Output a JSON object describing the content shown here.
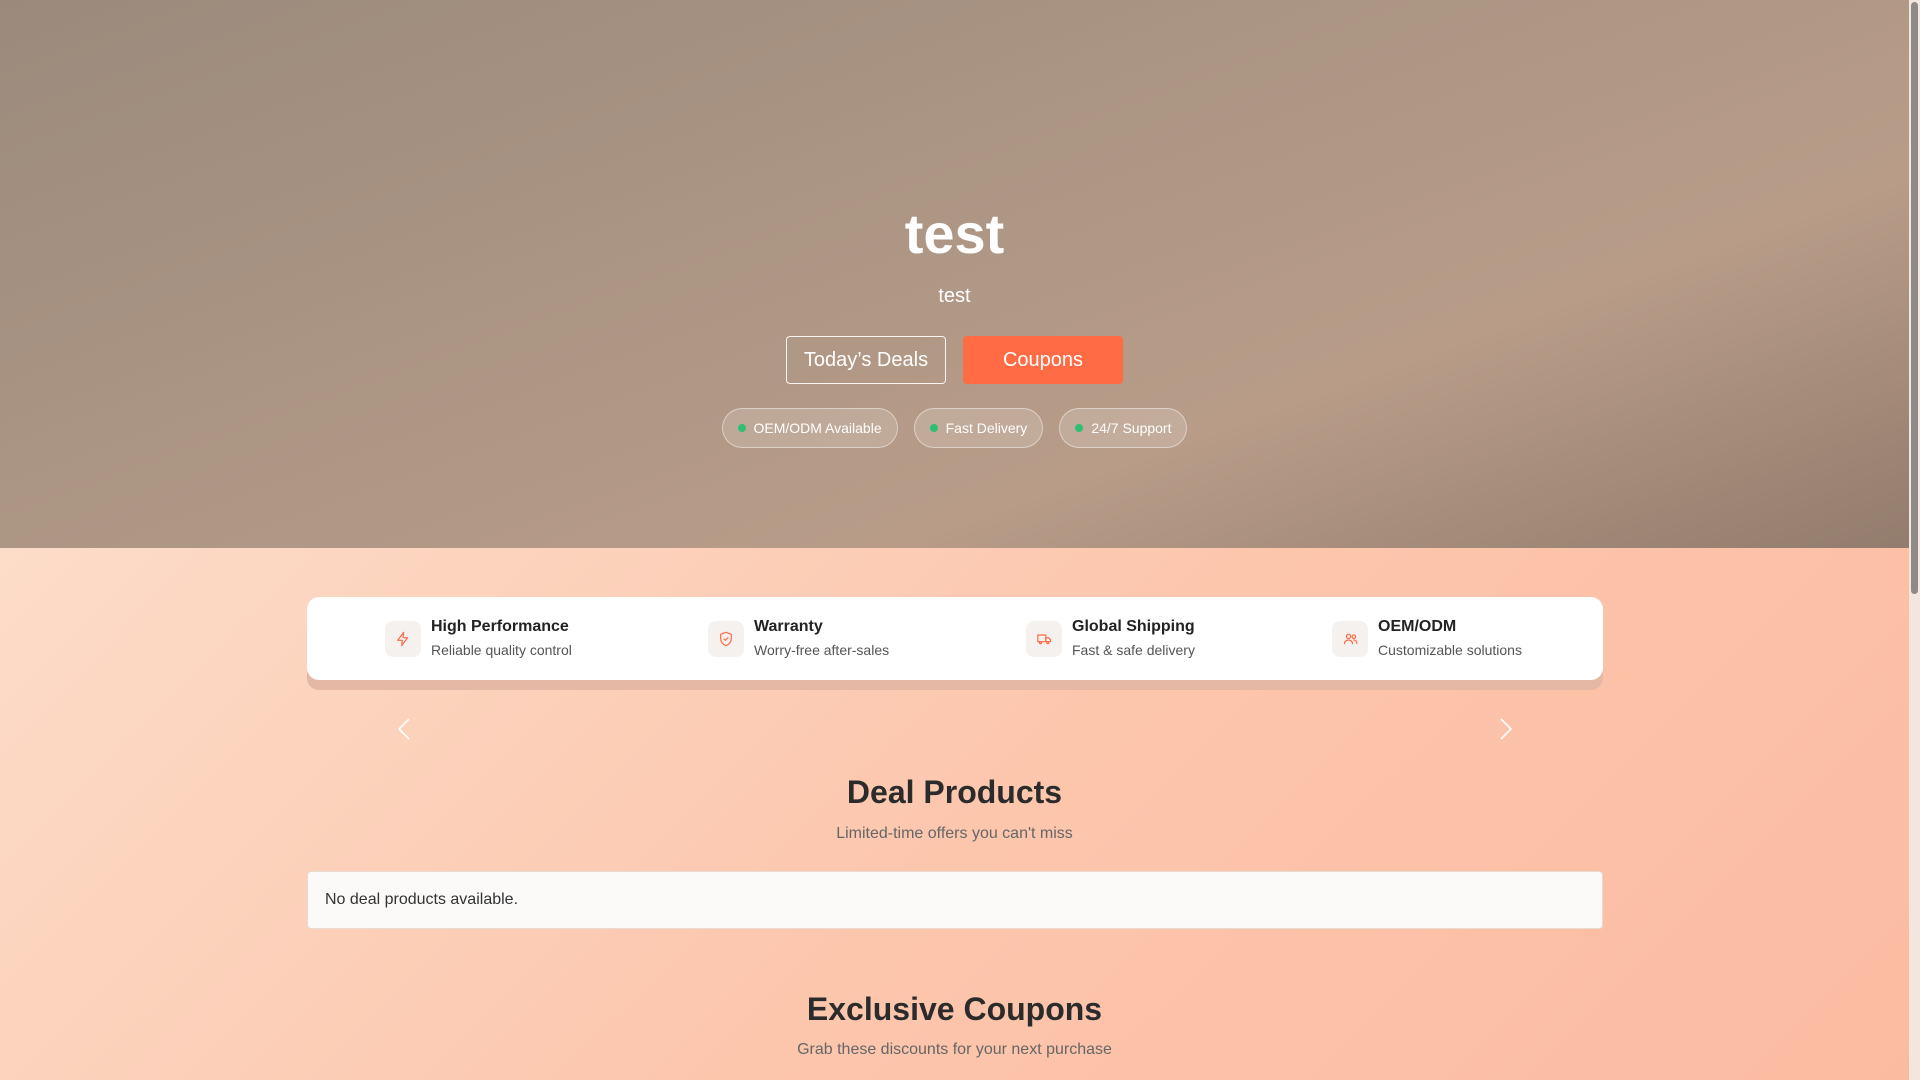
{
  "hero": {
    "title": "test",
    "subtitle": "test",
    "deals_button": "Today’s Deals",
    "coupons_button": "Coupons",
    "badges": [
      "OEM/ODM Available",
      "Fast Delivery",
      "24/7 Support"
    ]
  },
  "features": [
    {
      "icon": "lightning-icon",
      "title": "High Performance",
      "desc": "Reliable quality control"
    },
    {
      "icon": "shield-check-icon",
      "title": "Warranty",
      "desc": "Worry-free after-sales"
    },
    {
      "icon": "truck-icon",
      "title": "Global Shipping",
      "desc": "Fast & safe delivery"
    },
    {
      "icon": "users-icon",
      "title": "OEM/ODM",
      "desc": "Customizable solutions"
    }
  ],
  "deals": {
    "title": "Deal Products",
    "subtitle": "Limited-time offers you can't miss",
    "empty_message": "No deal products available."
  },
  "coupons": {
    "title": "Exclusive Coupons",
    "subtitle": "Grab these discounts for your next purchase"
  },
  "colors": {
    "accent": "#ff6b45",
    "status_dot": "#2fbf71",
    "icon_stroke": "#ff6b45"
  }
}
